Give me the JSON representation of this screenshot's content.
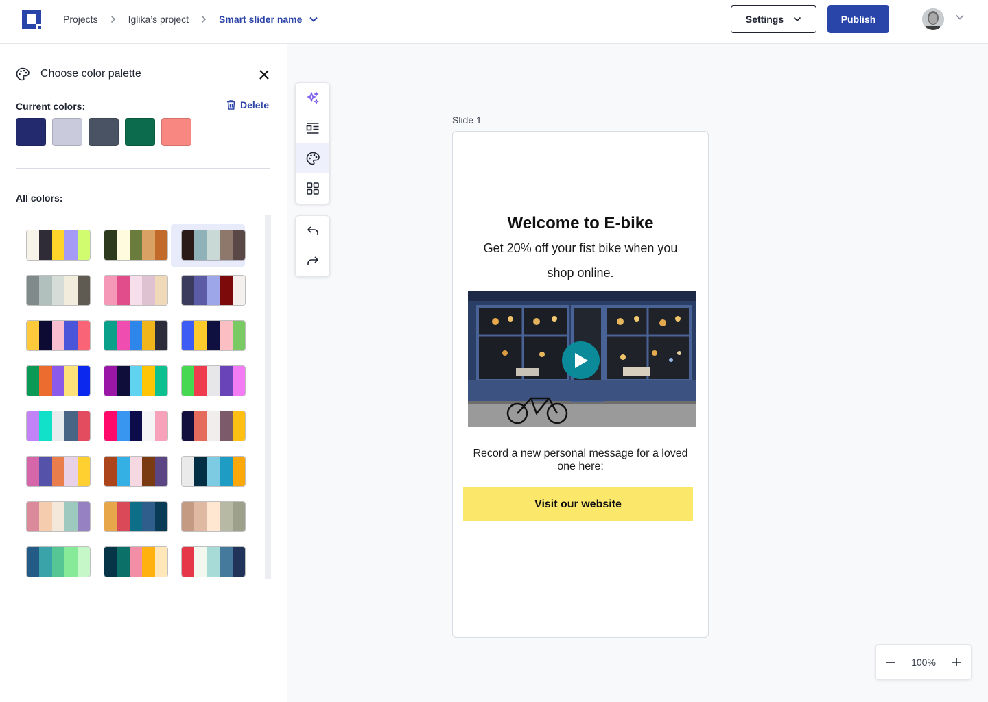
{
  "header": {
    "breadcrumbs": [
      "Projects",
      "Iglika’s project"
    ],
    "current_slider": "Smart slider name",
    "settings_label": "Settings",
    "publish_label": "Publish"
  },
  "panel": {
    "title": "Choose color palette",
    "current_label": "Current colors:",
    "delete_label": "Delete",
    "all_label": "All colors:",
    "current_colors": [
      "#232a6e",
      "#c9cbdc",
      "#4a5363",
      "#0b6b4c",
      "#f98781"
    ],
    "palettes": [
      [
        "#f8f3e8",
        "#2f2c37",
        "#ffd42a",
        "#a69af7",
        "#d2fc70"
      ],
      [
        "#2d3a1e",
        "#fffbdf",
        "#6b7d3c",
        "#d9a163",
        "#c16a2a"
      ],
      [
        "#2a1a18",
        "#8fb2b8",
        "#c9d9d6",
        "#8e786b",
        "#5a4847"
      ],
      [
        "#818a8b",
        "#b2c0bd",
        "#d6ddd8",
        "#f1ecdc",
        "#5f5a52"
      ],
      [
        "#f598b8",
        "#e04d8a",
        "#f6dfea",
        "#dfc2d1",
        "#f0d9b8"
      ],
      [
        "#3b3b5e",
        "#5b5ba6",
        "#9ea6ea",
        "#7c0a0a",
        "#f3f0ee"
      ],
      [
        "#ffc93c",
        "#0d0b33",
        "#f9bfd0",
        "#4a55d9",
        "#fa6477"
      ],
      [
        "#0aa08a",
        "#f04db1",
        "#2f86ea",
        "#efb51b",
        "#2c2c3b"
      ],
      [
        "#3d5cf3",
        "#ffca2b",
        "#101040",
        "#fbbec3",
        "#79ca63"
      ],
      [
        "#0a9a55",
        "#ec6b2f",
        "#8c5ae9",
        "#fde27a",
        "#0a28ee"
      ],
      [
        "#9a16a6",
        "#0f0d3a",
        "#5fd3ef",
        "#fec507",
        "#0cc08f"
      ],
      [
        "#47d851",
        "#ef3b4e",
        "#e7e7ea",
        "#6944b8",
        "#f37bf3"
      ],
      [
        "#c183f7",
        "#10e1c8",
        "#e8ecef",
        "#486585",
        "#e34b5e"
      ],
      [
        "#ff0a6a",
        "#3896f0",
        "#0c0c4a",
        "#f5f5f7",
        "#f7a1bb"
      ],
      [
        "#120f3e",
        "#e56c5c",
        "#f1eded",
        "#7d5a6a",
        "#ffc014"
      ],
      [
        "#d566a9",
        "#5552aa",
        "#ea7d4c",
        "#e9d2e7",
        "#ffd02f"
      ],
      [
        "#ad451c",
        "#34b0e5",
        "#f5d8e1",
        "#7a3b12",
        "#5c4583"
      ],
      [
        "#eaeaea",
        "#032f44",
        "#7ccbe3",
        "#1f9cc4",
        "#fca80b"
      ],
      [
        "#db8a9b",
        "#f6ccae",
        "#f3e8da",
        "#9ec9bf",
        "#9682c3"
      ],
      [
        "#e8a64a",
        "#da4957",
        "#0c6f87",
        "#2f5d8c",
        "#093b57"
      ],
      [
        "#c49a82",
        "#e0b9a3",
        "#ffe7d2",
        "#b7b9a4",
        "#9da18b"
      ],
      [
        "#235a86",
        "#3aa3a9",
        "#56c694",
        "#86ea98",
        "#c6f7c8"
      ],
      [
        "#063547",
        "#0b7168",
        "#f28ea6",
        "#ffb10f",
        "#ffe7ba"
      ],
      [
        "#e53747",
        "#f3f8ee",
        "#a7dbd8",
        "#457a9c",
        "#213358"
      ]
    ],
    "selected_palette": 2
  },
  "toolbar": {
    "tools": [
      "ai-sparkle-icon",
      "layout-icon",
      "palette-icon",
      "grid-icon"
    ],
    "history": [
      "undo-icon",
      "redo-icon"
    ]
  },
  "slide": {
    "label": "Slide 1",
    "title": "Welcome to E-bike",
    "subtitle": "Get 20% off your fist bike when you shop online.",
    "message": "Record a new personal message for a loved one here:",
    "cta": "Visit our website"
  },
  "zoom": {
    "level": "100%"
  },
  "colors": {
    "accent": "#2a45aa",
    "cta": "#fbe86a",
    "play": "#0b8a9a"
  }
}
